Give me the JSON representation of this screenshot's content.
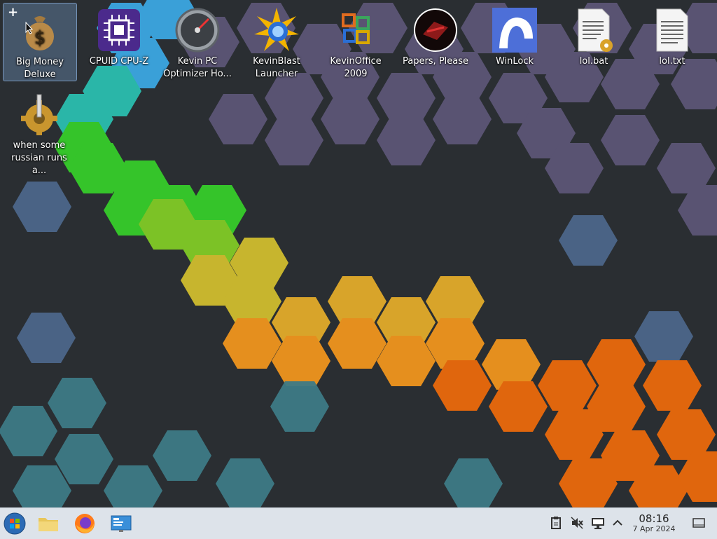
{
  "desktop": {
    "icons": [
      {
        "label": "Big Money Deluxe",
        "icon": "money-bag-icon"
      },
      {
        "label": "CPUID CPU-Z",
        "icon": "cpu-chip-icon"
      },
      {
        "label": "Kevin PC Optimizer Ho...",
        "icon": "speedometer-icon"
      },
      {
        "label": "KevinBlast Launcher",
        "icon": "starburst-icon"
      },
      {
        "label": "KevinOffice 2009",
        "icon": "office-logo-icon"
      },
      {
        "label": "Papers, Please",
        "icon": "papers-please-emblem-icon"
      },
      {
        "label": "WinLock",
        "icon": "winlock-icon"
      },
      {
        "label": "lol.bat",
        "icon": "batch-file-icon"
      },
      {
        "label": "lol.txt",
        "icon": "text-file-icon"
      },
      {
        "label": "when some russian runs a...",
        "icon": "gear-icon"
      }
    ],
    "selected_plus": "+"
  },
  "taskbar": {
    "apps": [
      {
        "name": "start-menu",
        "icon": "windows-orb-icon"
      },
      {
        "name": "file-manager",
        "icon": "folder-icon"
      },
      {
        "name": "firefox",
        "icon": "firefox-icon"
      },
      {
        "name": "system-settings",
        "icon": "monitor-settings-icon"
      }
    ],
    "tray": {
      "icons": [
        "clipboard-icon",
        "volume-muted-icon",
        "display-icon",
        "chevron-up-icon"
      ],
      "time": "08:16",
      "date": "7 Apr 2024"
    }
  },
  "colors": {
    "taskbar_bg": "#dde3ea",
    "wallpaper_bg": "#2b2f33",
    "hex_purple": "#5f5878",
    "hex_orange": "#e0660d",
    "hex_yellow": "#d4a52a",
    "hex_green": "#3fc52c",
    "hex_teal": "#3f7f8a"
  }
}
